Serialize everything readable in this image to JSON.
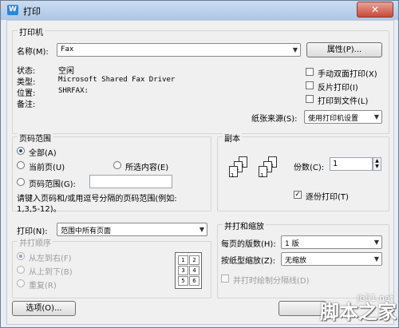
{
  "window": {
    "title": "打印",
    "app_icon": "W"
  },
  "printer": {
    "group_label": "打印机",
    "name_label": "名称(M):",
    "name_value": "Fax",
    "properties_btn": "属性(P)...",
    "status_label": "状态:",
    "status_value": "空闲",
    "type_label": "类型:",
    "type_value": "Microsoft Shared Fax Driver",
    "where_label": "位置:",
    "where_value": "SHRFAX:",
    "comment_label": "备注:",
    "duplex_label": "手动双面打印(X)",
    "reverse_label": "反片打印(I)",
    "tofile_label": "打印到文件(L)",
    "source_label": "纸张来源(S):",
    "source_value": "使用打印机设置"
  },
  "page_range": {
    "group_label": "页码范围",
    "all_label": "全部(A)",
    "current_label": "当前页(U)",
    "selection_label": "所选内容(E)",
    "pages_label": "页码范围(G):",
    "hint_line1": "请键入页码和/或用逗号分隔的页码范围(例如:",
    "hint_line2": "1,3,5-12)。"
  },
  "copies": {
    "group_label": "副本",
    "count_label": "份数(C):",
    "count_value": "1",
    "collate_label": "逐份打印(T)"
  },
  "print_what": {
    "label": "打印(N):",
    "value": "范围中所有页面",
    "order_label": "并打顺序",
    "ltr_label": "从左到右(F)",
    "ttb_label": "从上到下(B)",
    "repeat_label": "重复(R)",
    "grid": [
      "1",
      "2",
      "3",
      "4",
      "5",
      "6"
    ]
  },
  "zoom": {
    "group_label": "并打和缩放",
    "pages_per_sheet_label": "每页的版数(H):",
    "pages_per_sheet_value": "1 版",
    "scale_label": "按纸型缩放(Z):",
    "scale_value": "无缩放",
    "divider_label": "并打时绘制分隔线(D)"
  },
  "footer": {
    "options_btn": "选项(O)..."
  },
  "watermark": {
    "site": "jb51.net",
    "brand": "脚本之家"
  }
}
